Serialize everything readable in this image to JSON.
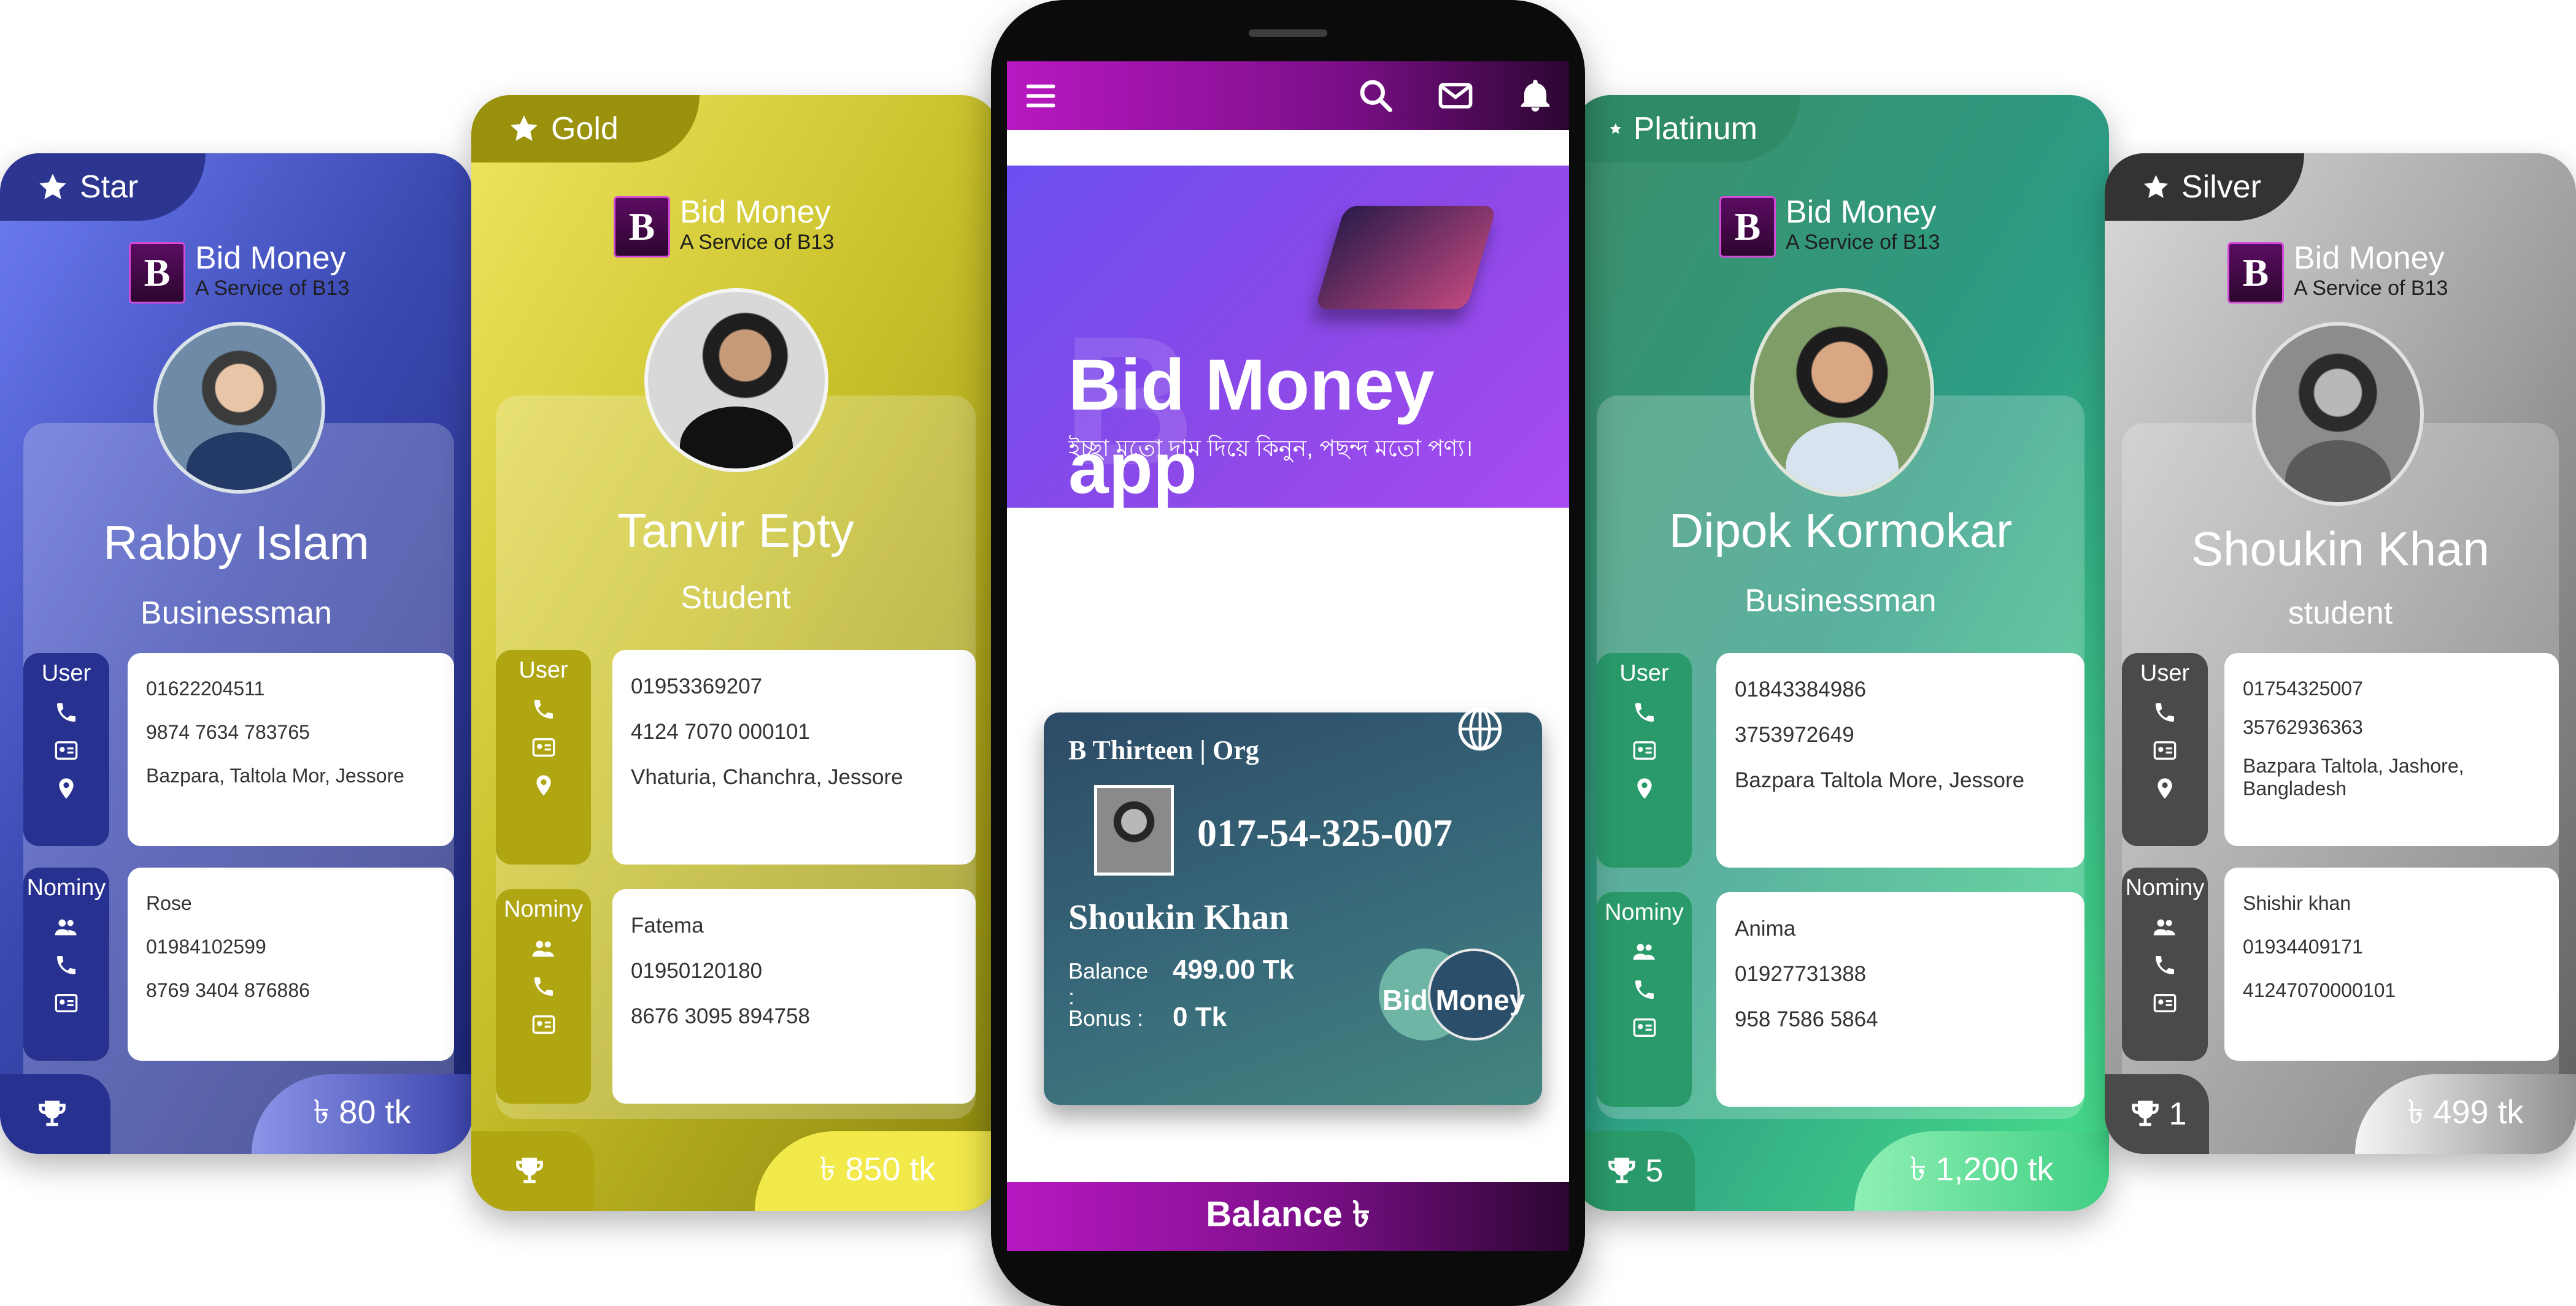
{
  "cards": {
    "star": {
      "tier": "Star",
      "brand_name": "Bid Money",
      "brand_sub": "A Service of B13",
      "name": "Rabby Islam",
      "role": "Businessman",
      "user_label": "User",
      "phone": "01622204511",
      "nid": "9874 7634 783765",
      "address": "Bazpara, Taltola Mor, Jessore",
      "nominy_label": "Nominy",
      "nominy_name": "Rose",
      "nominy_phone": "01984102599",
      "nominy_nid": "8769 3404 876886",
      "trophy_count": "",
      "amount": "৳ 80 tk"
    },
    "gold": {
      "tier": "Gold",
      "brand_name": "Bid Money",
      "brand_sub": "A Service of B13",
      "name": "Tanvir Epty",
      "role": "Student",
      "user_label": "User",
      "phone": "01953369207",
      "nid": "4124 7070 000101",
      "address": "Vhaturia, Chanchra, Jessore",
      "nominy_label": "Nominy",
      "nominy_name": "Fatema",
      "nominy_phone": "01950120180",
      "nominy_nid": "8676 3095 894758",
      "trophy_count": "",
      "amount": "৳ 850 tk"
    },
    "platinum": {
      "tier": "Platinum",
      "brand_name": "Bid Money",
      "brand_sub": "A Service of B13",
      "name": "Dipok Kormokar",
      "role": "Businessman",
      "user_label": "User",
      "phone": "01843384986",
      "nid": "3753972649",
      "address": "Bazpara Taltola More, Jessore",
      "nominy_label": "Nominy",
      "nominy_name": "Anima",
      "nominy_phone": "01927731388",
      "nominy_nid": "958 7586 5864",
      "trophy_count": "5",
      "amount": "৳ 1,200 tk"
    },
    "silver": {
      "tier": "Silver",
      "brand_name": "Bid Money",
      "brand_sub": "A Service of B13",
      "name": "Shoukin Khan",
      "role": "student",
      "user_label": "User",
      "phone": "01754325007",
      "nid": "35762936363",
      "address": "Bazpara Taltola, Jashore, Bangladesh",
      "nominy_label": "Nominy",
      "nominy_name": "Shishir khan",
      "nominy_phone": "01934409171",
      "nominy_nid": "41247070000101",
      "trophy_count": "1",
      "amount": "৳ 499 tk"
    }
  },
  "phone": {
    "banner_title": "Bid Money app",
    "banner_sub": "ইচ্ছা মতো দাম দিয়ে কিনুন, পছন্দ মতো পণ্য।",
    "banner_watermark": "B",
    "id_card": {
      "org": "B Thirteen | Org",
      "number": "017-54-325-007",
      "name": "Shoukin Khan",
      "balance_label": "Balance :",
      "balance_value": "499.00 Tk",
      "bonus_label": "Bonus :",
      "bonus_value": "0 Tk",
      "logo_text": "Bid Money"
    },
    "balance_button": "Balance ৳"
  },
  "icons": {
    "header": [
      "menu-icon",
      "search-icon",
      "mail-icon",
      "bell-icon"
    ],
    "card_side": [
      "phone-icon",
      "id-card-icon",
      "location-icon",
      "users-icon",
      "trophy-icon",
      "star-icon",
      "globe-icon"
    ]
  },
  "colors": {
    "phone_header": "#b818c2",
    "banner": "#8a49e8",
    "star_card": "#3a48b0",
    "gold_card": "#c9c12a",
    "platinum_card": "#2c9b83",
    "silver_card": "#9e9e9e"
  }
}
